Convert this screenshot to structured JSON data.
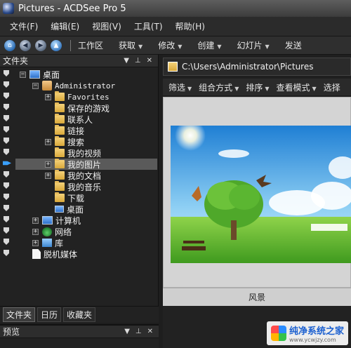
{
  "window": {
    "title": "Pictures - ACDSee Pro 5"
  },
  "menubar": {
    "items": [
      "文件(F)",
      "编辑(E)",
      "视图(V)",
      "工具(T)",
      "帮助(H)"
    ]
  },
  "toolbar": {
    "items": [
      "工作区",
      "获取",
      "修改",
      "创建",
      "幻灯片",
      "发送"
    ]
  },
  "left_panel": {
    "title": "文件夹",
    "tree": {
      "desktop": "桌面",
      "administrator": "Administrator",
      "favorites": "Favorites",
      "saved_games": "保存的游戏",
      "contacts": "联系人",
      "links": "链接",
      "searches": "搜索",
      "my_videos": "我的视频",
      "my_pictures": "我的图片",
      "my_documents": "我的文档",
      "my_music": "我的音乐",
      "downloads": "下载",
      "desktop_sub": "桌面",
      "computer": "计算机",
      "network": "网络",
      "library": "库",
      "offline_media": "脱机媒体"
    },
    "tabs": [
      "文件夹",
      "日历",
      "收藏夹"
    ]
  },
  "preview_panel": {
    "title": "预览"
  },
  "right_panel": {
    "path": "C:\\Users\\Administrator\\Pictures",
    "filters": [
      "筛选",
      "组合方式",
      "排序",
      "查看模式",
      "选择"
    ],
    "thumbnail_caption": "风景"
  },
  "watermark": {
    "title": "纯净系统之家",
    "url": "www.ycwjzy.com"
  }
}
